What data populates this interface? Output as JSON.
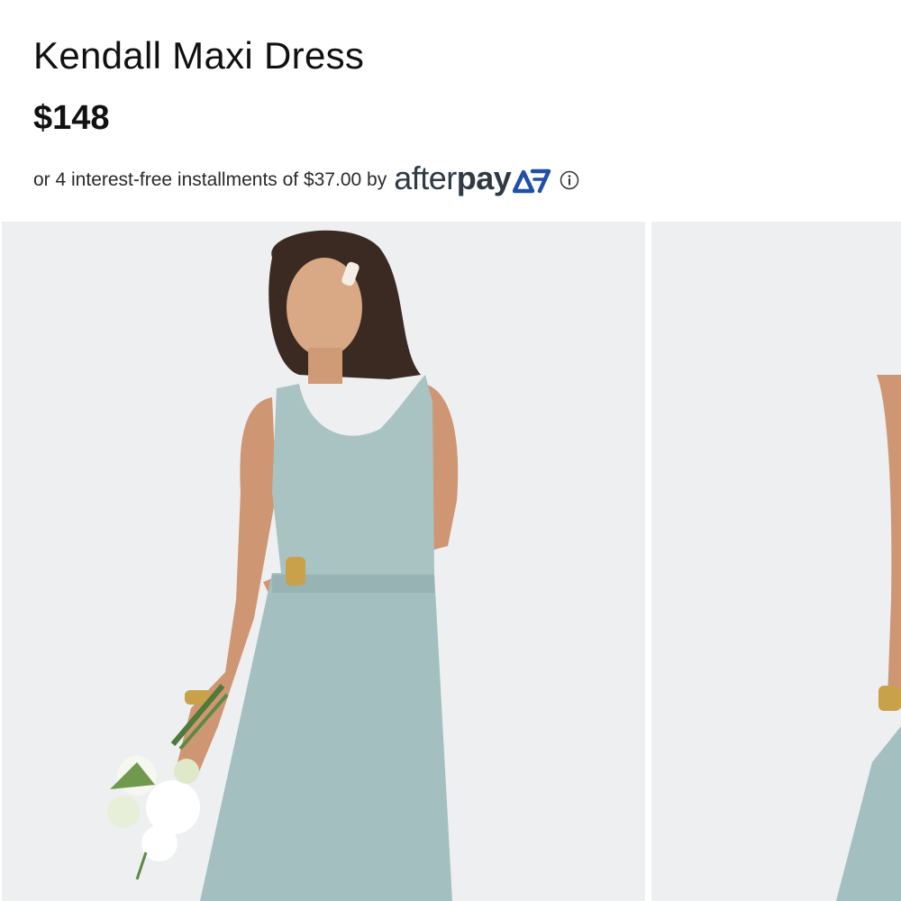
{
  "product": {
    "title": "Kendall Maxi Dress",
    "price": "$148"
  },
  "afterpay": {
    "installment_text": "or 4 interest-free installments of $37.00 by",
    "brand_light": "after",
    "brand_bold": "pay",
    "logo_icon": "afterpay-arrows-icon",
    "info_icon": "info-circle-icon"
  },
  "gallery": {
    "images": [
      {
        "name": "model-front-photo"
      },
      {
        "name": "model-side-photo"
      }
    ]
  },
  "colors": {
    "dress": "#a9c3c3",
    "background": "#eeeff1",
    "afterpay_text": "#2f3a44",
    "afterpay_mark": "#1f4fa8"
  }
}
